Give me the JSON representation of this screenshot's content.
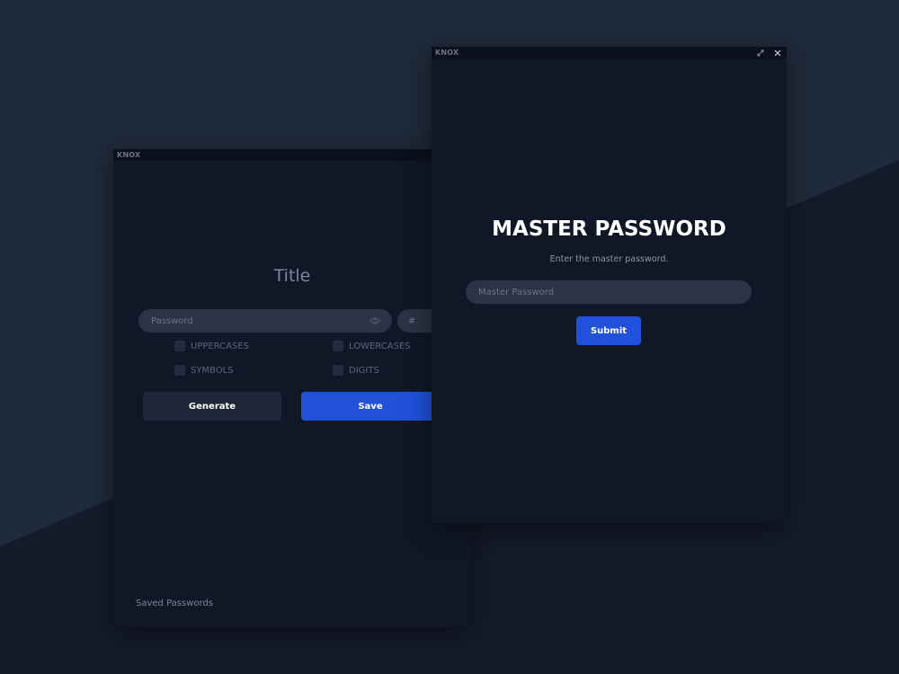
{
  "theme": {
    "page_bg_dark": "#151b2b",
    "page_bg_light": "#1f2a3a",
    "window_bg": "#101727",
    "titlebar_bg": "#0b101c",
    "input_bg": "#2a3446",
    "accent": "#2150db",
    "secondary_button": "#1e2737"
  },
  "back_window": {
    "app_name": "KNOX",
    "title": "Title",
    "password_placeholder": "Password",
    "length_placeholder": "#",
    "options": [
      {
        "label": "UPPERCASES",
        "checked": false
      },
      {
        "label": "LOWERCASES",
        "checked": false
      },
      {
        "label": "SYMBOLS",
        "checked": false
      },
      {
        "label": "DIGITS",
        "checked": false
      }
    ],
    "generate_label": "Generate",
    "save_label": "Save",
    "saved_passwords_label": "Saved Passwords",
    "eye_icon": "eye-icon"
  },
  "front_window": {
    "app_name": "KNOX",
    "title": "MASTER PASSWORD",
    "subtitle": "Enter the master password.",
    "input_placeholder": "Master Password",
    "submit_label": "Submit",
    "titlebar_icons": [
      "minimize-icon",
      "close-icon"
    ]
  }
}
